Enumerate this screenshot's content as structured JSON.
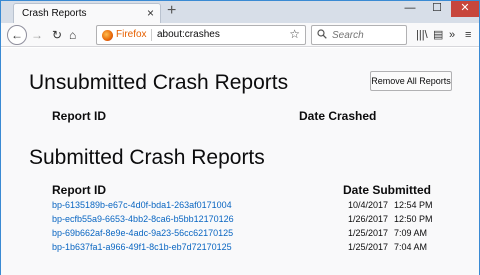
{
  "browser": {
    "tab_title": "Crash Reports",
    "tab_close": "×",
    "new_tab": "+",
    "window_controls": {
      "minimize": "—",
      "maximize": "☐",
      "close": "✕"
    }
  },
  "navbar": {
    "back": "←",
    "forward": "→",
    "reload": "↻",
    "home": "⌂",
    "identity_label": "Firefox",
    "url": "about:crashes",
    "bookmark_star": "☆",
    "search_placeholder": "Search",
    "icons": {
      "library": "|||\\",
      "sidebar": "▤",
      "overflow": "»",
      "menu": "≡"
    }
  },
  "unsubmitted": {
    "heading": "Unsubmitted Crash Reports",
    "remove_button": "Remove All Reports",
    "col_id": "Report ID",
    "col_date": "Date Crashed",
    "rows": []
  },
  "submitted": {
    "heading": "Submitted Crash Reports",
    "col_id": "Report ID",
    "col_date": "Date Submitted",
    "rows": [
      {
        "id": "bp-6135189b-e67c-4d0f-bda1-263af0171004",
        "date": "10/4/2017",
        "time": "12:54 PM"
      },
      {
        "id": "bp-ecfb55a9-6653-4bb2-8ca6-b5bb12170126",
        "date": "1/26/2017",
        "time": "12:50 PM"
      },
      {
        "id": "bp-69b662af-8e9e-4adc-9a23-56cc62170125",
        "date": "1/25/2017",
        "time": "7:09 AM"
      },
      {
        "id": "bp-1b637fa1-a966-49f1-8c1b-eb7d72170125",
        "date": "1/25/2017",
        "time": "7:04 AM"
      }
    ]
  }
}
